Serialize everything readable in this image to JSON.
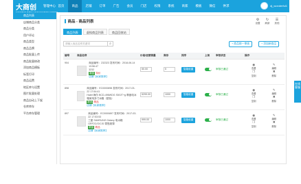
{
  "header": {
    "logo": "大商创",
    "logo_sub": "ECMOBAN B2B2C MANAGEMENT CENTER",
    "title": "管理中心",
    "nav": [
      "首页",
      "商品",
      "店铺",
      "订单",
      "广告",
      "会员",
      "门店",
      "权限",
      "系统",
      "商家",
      "模板",
      "微信",
      "供求"
    ],
    "username": "dj_wonderful1"
  },
  "sidebar": {
    "items": [
      "商品列表",
      "店铺商品分类",
      "商品分类",
      "用户评论",
      "商品类型",
      "商品品牌",
      "商品批量上传",
      "商品批量修改",
      "添加商品模板",
      "标签打印",
      "商品运费",
      "地区库与设置",
      "图片批量处理",
      "商品自动上下架",
      "仓库库存",
      "平台库存管理"
    ]
  },
  "page": {
    "title": "商品 - 商品列表",
    "tools": [
      {
        "icon": "⚙",
        "label": "设置"
      },
      {
        "icon": "↻",
        "label": "刷新"
      },
      {
        "icon": "☰",
        "label": "其他"
      }
    ]
  },
  "tabs": [
    "商品列表",
    "虚拟商品列表",
    "商品回收站"
  ],
  "search": {
    "placeholder": "请输入商品名称关键词",
    "btn": "⌕"
  },
  "buttons": {
    "add": "+ 添加新商品",
    "audit": "+ 商品统一审核"
  },
  "columns": [
    "编号",
    "商品名称",
    "价格/运营销量",
    "库存",
    "排序",
    "上架",
    "审核状态",
    "操作"
  ],
  "rows": [
    {
      "id": "904",
      "sn": "商品编号：232323",
      "date": "发布时间：2018-06-14 13:56:47",
      "name": "3232",
      "tag": "新品",
      "special": "特价",
      "label": "店铺【私家推荐】",
      "price": "50.00",
      "stock": "5",
      "sort": "智能权重",
      "status": "审核已通过",
      "ops": [
        "查看",
        "编辑",
        "复制",
        "删除"
      ]
    },
    {
      "id": "898",
      "sn": "商品编号：EC0000898",
      "date": "发布时间：2017-03-22 17:54:41",
      "name": "Haier/海尔 BCD-496WDG",
      "desc": "S5G/T+g 尊嵌电冰箱家用多门冰箱（银色）",
      "tag": "新品",
      "special": "精品",
      "label": "店铺【私家推荐】",
      "price": "5299.00",
      "stock": "1000",
      "sort": "智能权重",
      "status": "审核已通过",
      "ops": [
        "查看",
        "编辑",
        "复制",
        "删除"
      ]
    },
    {
      "id": "897",
      "sn": "商品编号：EC0000897",
      "date": "发布时间：2017-03-22 17:53:53",
      "name": "三星 SAMSUNG",
      "desc": "Galaxy 电冰箱 GRF2C/G/C/D 零售超薄",
      "tag": "新品",
      "special": "精品",
      "label": "店铺【私家推荐】",
      "price": "999.00",
      "stock": "1000",
      "sort": "智能权重",
      "status": "审核已通过",
      "ops": [
        "查看",
        "编辑",
        "复制",
        "删除"
      ]
    }
  ],
  "floating": "在线客服"
}
